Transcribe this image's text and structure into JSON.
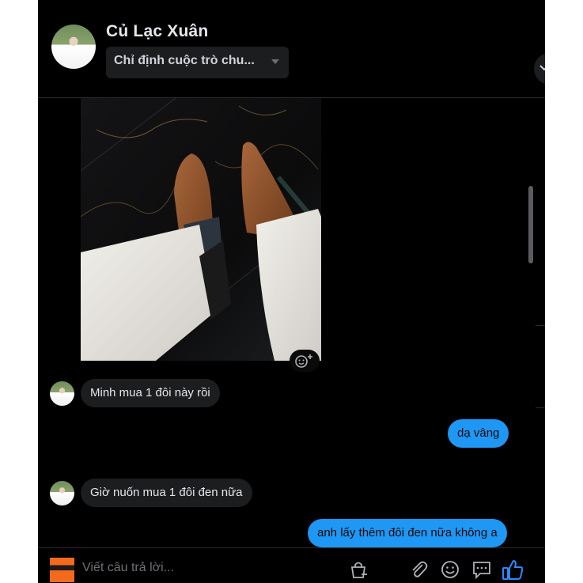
{
  "header": {
    "contact_name": "Củ Lạc Xuân",
    "nickname_value": "Chỉ định cuộc trò chu..."
  },
  "messages": [
    {
      "direction": "incoming",
      "text": "Minh mua 1 đôi này rồi"
    },
    {
      "direction": "outgoing",
      "text": "dạ vâng"
    },
    {
      "direction": "incoming",
      "text": "Giờ nuốn mua 1 đôi đen nữa"
    },
    {
      "direction": "outgoing",
      "text": "anh lấy thêm đôi đen nữa không a"
    }
  ],
  "composer": {
    "placeholder": "Viết câu trả lời..."
  },
  "icons": [
    "smile-plus-icon",
    "chevron-down-icon",
    "bag-icon",
    "paperclip-icon",
    "emoji-icon",
    "saved-reply-icon",
    "thumbs-up-icon"
  ],
  "colors": {
    "background": "#000000",
    "incoming_bubble": "#1c1d1f",
    "outgoing_bubble": "#1f97f4",
    "accent": "#2d88ff"
  }
}
